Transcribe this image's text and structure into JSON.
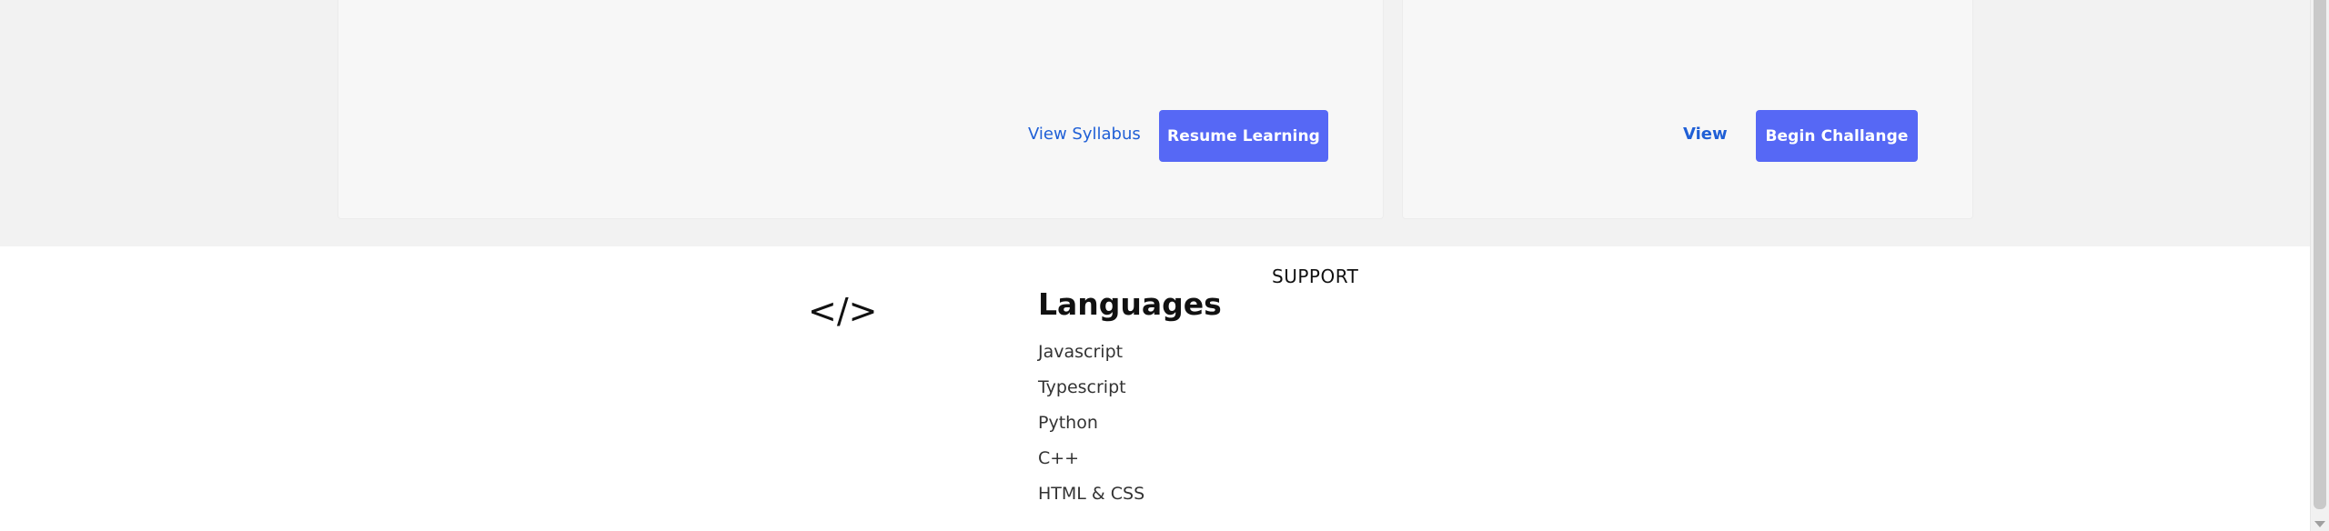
{
  "course_card": {
    "view_syllabus_label": "View Syllabus",
    "resume_label": "Resume Learning"
  },
  "challenge_card": {
    "view_label": "View",
    "begin_label": "Begin Challange"
  },
  "footer": {
    "logo_text": "</>",
    "support_heading": "SUPPORT",
    "languages_heading": "Languages",
    "languages": [
      "Javascript",
      "Typescript",
      "Python",
      "C++",
      "HTML & CSS"
    ]
  },
  "colors": {
    "accent": "#5668f5",
    "link": "#1f5fd6"
  }
}
